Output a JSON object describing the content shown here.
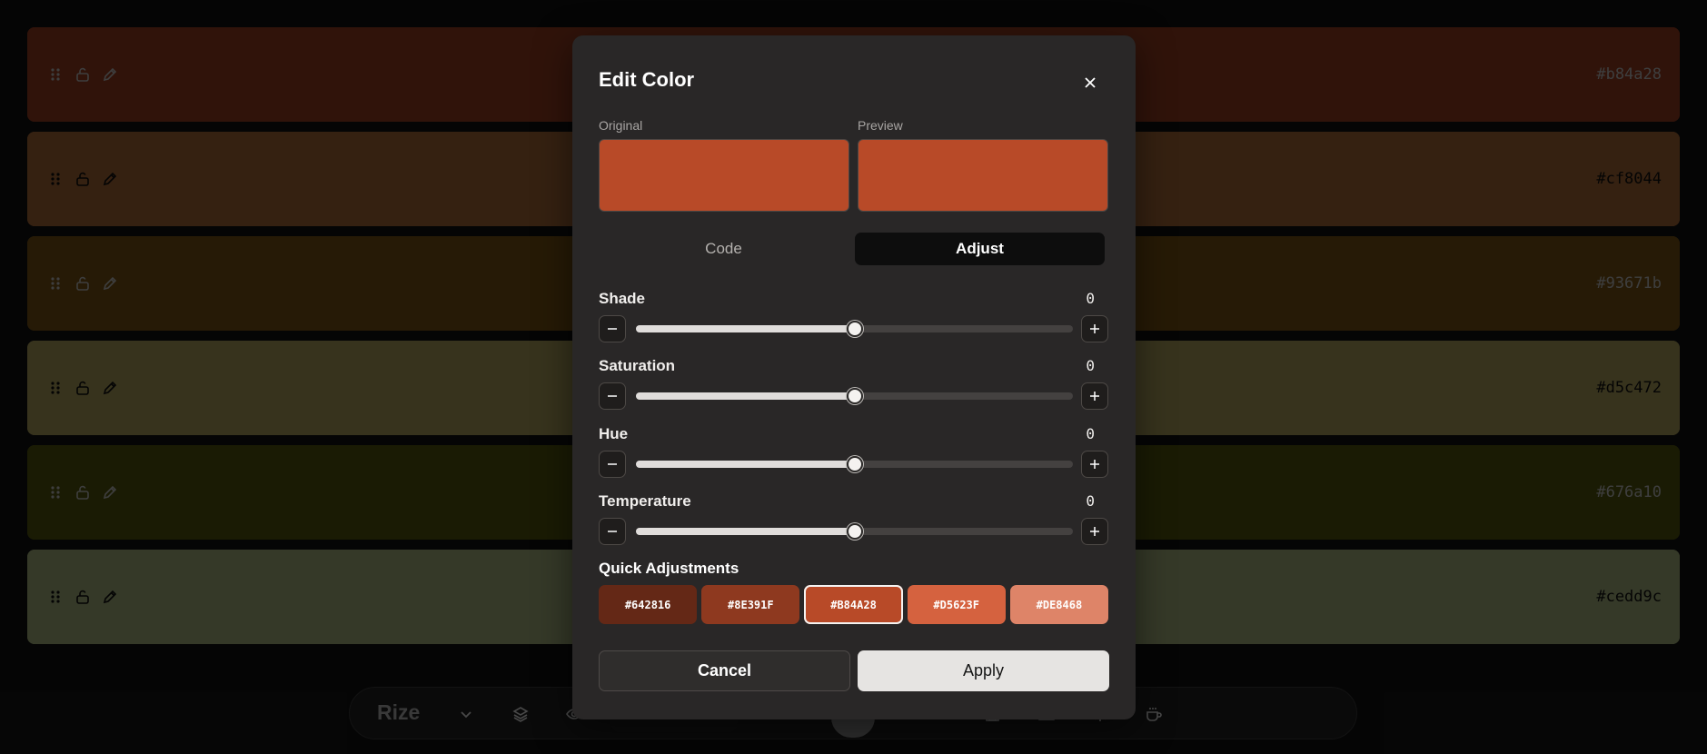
{
  "palette": [
    {
      "hex": "#b84a28",
      "bg": "#b84a28",
      "fg": "#eeeeee"
    },
    {
      "hex": "#cf8044",
      "bg": "#cf8044",
      "fg": "#111111"
    },
    {
      "hex": "#93671b",
      "bg": "#93671b",
      "fg": "#eeeeee"
    },
    {
      "hex": "#d5c472",
      "bg": "#d5c472",
      "fg": "#111111"
    },
    {
      "hex": "#676a10",
      "bg": "#676a10",
      "fg": "#eeeeee"
    },
    {
      "hex": "#cedd9c",
      "bg": "#cedd9c",
      "fg": "#111111"
    }
  ],
  "toolbar": {
    "brand": "Rize"
  },
  "modal": {
    "title": "Edit Color",
    "original_label": "Original",
    "preview_label": "Preview",
    "original_color": "#b84a28",
    "preview_color": "#b84a28",
    "tabs": {
      "code": "Code",
      "adjust": "Adjust",
      "active": "adjust"
    },
    "sliders": [
      {
        "label": "Shade",
        "value": "0",
        "fraction": 0.5
      },
      {
        "label": "Saturation",
        "value": "0",
        "fraction": 0.5
      },
      {
        "label": "Hue",
        "value": "0",
        "fraction": 0.5
      },
      {
        "label": "Temperature",
        "value": "0",
        "fraction": 0.5
      }
    ],
    "quick_label": "Quick Adjustments",
    "quick": [
      {
        "label": "#642816",
        "color": "#642816"
      },
      {
        "label": "#8E391F",
        "color": "#8e391f"
      },
      {
        "label": "#B84A28",
        "color": "#b84a28",
        "selected": true
      },
      {
        "label": "#D5623F",
        "color": "#d5623f"
      },
      {
        "label": "#DE8468",
        "color": "#de8468"
      }
    ],
    "cancel_label": "Cancel",
    "apply_label": "Apply"
  }
}
